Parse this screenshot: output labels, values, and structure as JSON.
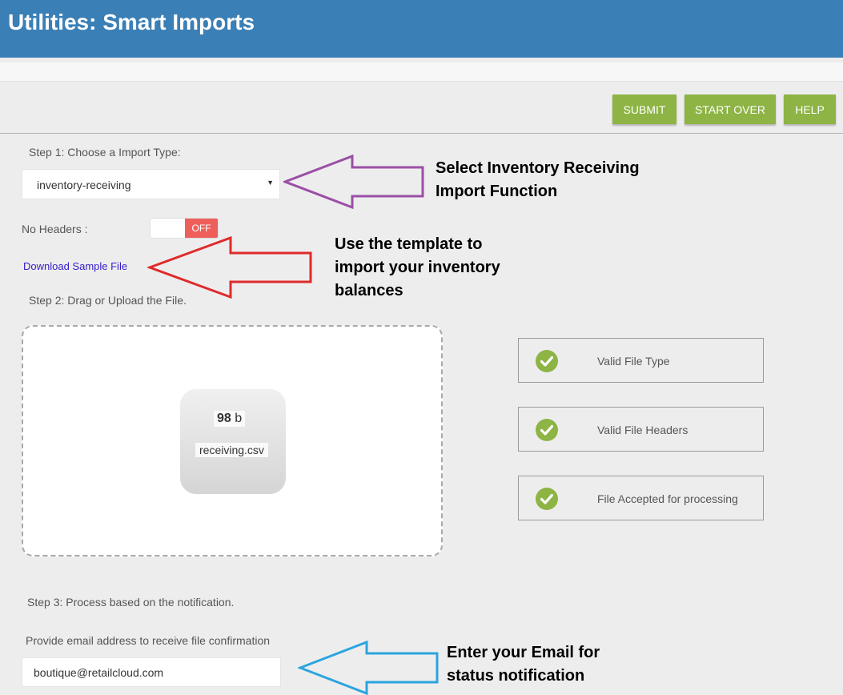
{
  "header": {
    "title": "Utilities: Smart Imports"
  },
  "toolbar": {
    "submit_label": "SUBMIT",
    "start_over_label": "START OVER",
    "help_label": "HELP"
  },
  "step1": {
    "label": "Step 1: Choose a Import Type:",
    "selected_value": "inventory-receiving"
  },
  "no_headers": {
    "label": "No Headers :",
    "toggle_state": "OFF"
  },
  "download": {
    "label": "Download Sample File"
  },
  "step2": {
    "label": "Step 2: Drag or Upload the File."
  },
  "file": {
    "size_number": "98",
    "size_unit": "b",
    "name": "receiving.csv"
  },
  "checks": [
    {
      "label": "Valid File Type"
    },
    {
      "label": "Valid File Headers"
    },
    {
      "label": "File Accepted for processing"
    }
  ],
  "step3": {
    "label": "Step 3: Process based on the notification."
  },
  "email": {
    "label": "Provide email address to receive file confirmation",
    "value": "boutique@retailcloud.com"
  },
  "annotations": {
    "select_line1": "Select Inventory Receiving",
    "select_line2": "Import Function",
    "template_line1": "Use the template to",
    "template_line2": "import your inventory",
    "template_line3": "balances",
    "email_line1": "Enter your Email for",
    "email_line2": "status notification"
  },
  "colors": {
    "header": "#3a7fb5",
    "button": "#8db444",
    "toggle_off": "#ee5f5b",
    "check": "#8db444",
    "link": "#3520c8",
    "arrow_purple": "#9b4fa6",
    "arrow_red": "#e02a2a",
    "arrow_blue": "#2aa5de"
  }
}
